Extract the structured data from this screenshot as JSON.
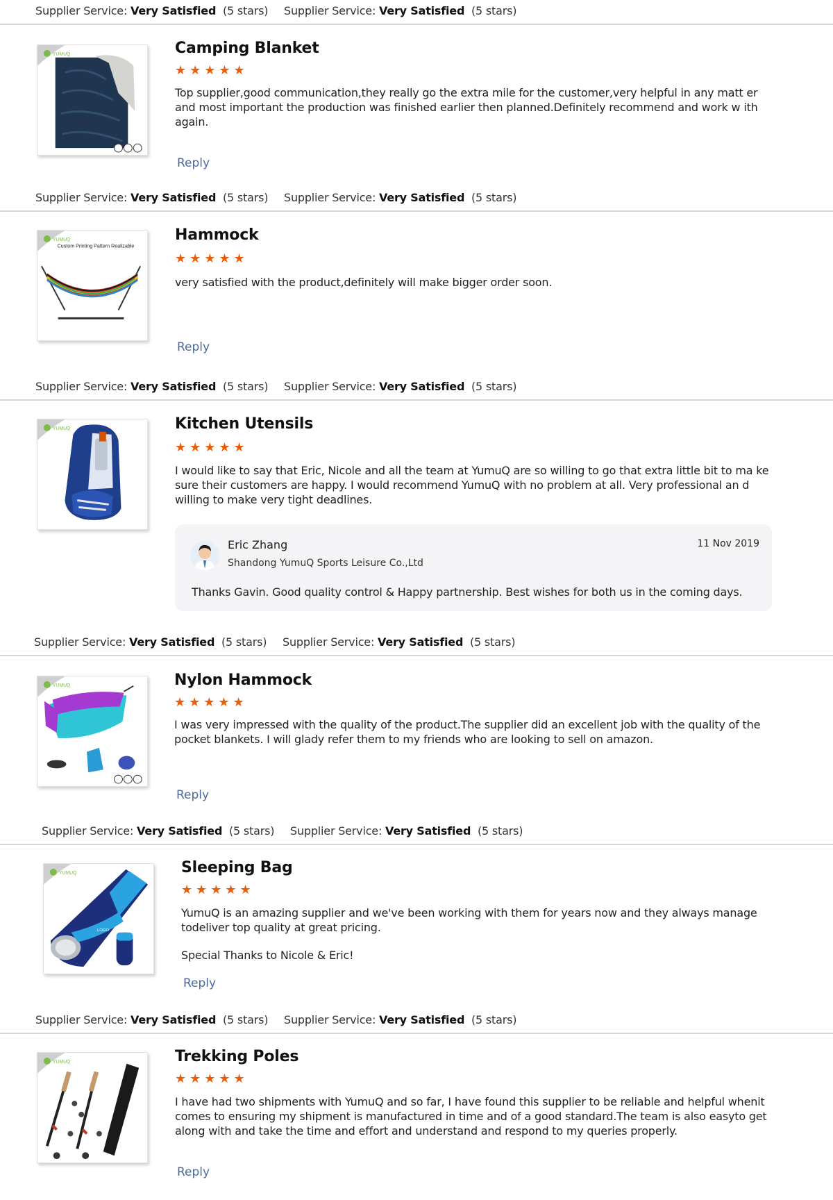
{
  "service_rows": [
    {
      "label": "Supplier Service:",
      "rating": "Very Satisfied",
      "stars": "(5 stars)"
    },
    {
      "label": "Supplier Service:",
      "rating": "Very Satisfied",
      "stars": "(5 stars)"
    }
  ],
  "reviews": [
    {
      "title": "Camping Blanket",
      "stars": "★★★★★",
      "rating": 5,
      "text": [
        "Top supplier,good communication,they really go the extra mile for the customer,very helpful in any matt er and most important the production was finished earlier then planned.Definitely recommend and work w ith again."
      ],
      "reply_label": "Reply",
      "image_icon": "camping-blanket-image"
    },
    {
      "title": "Hammock",
      "stars": "★★★★★",
      "rating": 5,
      "text": [
        "very satisfied with the product,definitely will make bigger order soon."
      ],
      "reply_label": "Reply",
      "image_icon": "hammock-image",
      "image_caption": "Custom Printing Pattern Realizable"
    },
    {
      "title": "Kitchen Utensils",
      "stars": "★★★★★",
      "rating": 5,
      "text": [
        "I would like to say that Eric, Nicole and all the team at YumuQ are so willing to go that extra little bit to ma ke sure their customers are happy. I would recommend YumuQ with no problem at all. Very professional an d willing to make very tight deadlines."
      ],
      "image_icon": "kitchen-utensils-image",
      "response": {
        "name": "Eric Zhang",
        "company": "Shandong YumuQ Sports Leisure Co.,Ltd",
        "date": "11 Nov 2019",
        "text": "Thanks Gavin. Good quality control & Happy partnership. Best wishes for both us in the coming days."
      }
    },
    {
      "title": "Nylon Hammock",
      "stars": "★★★★★",
      "rating": 5,
      "text": [
        "I was very impressed with the quality of the product.The supplier did an excellent job with the quality of the pocket blankets. I will glady refer them to my friends who are looking to sell on amazon."
      ],
      "reply_label": "Reply",
      "image_icon": "nylon-hammock-image"
    },
    {
      "title": "Sleeping Bag",
      "stars": "★★★★★",
      "rating": 5,
      "text": [
        "YumuQ is an amazing supplier and we've been working with them for years now and they always manage todeliver top quality at great pricing.",
        "Special Thanks to Nicole & Eric!"
      ],
      "reply_label": "Reply",
      "image_icon": "sleeping-bag-image",
      "image_label": "LOGO"
    },
    {
      "title": "Trekking Poles",
      "stars": "★★★★★",
      "rating": 5,
      "text": [
        "I have had two shipments with YumuQ and so far, I have found this supplier to be reliable and helpful whenit comes to ensuring my shipment is manufactured in time and of a good standard.The team is also easyto get along with and take the time and effort and understand and respond to my queries properly."
      ],
      "reply_label": "Reply",
      "image_icon": "trekking-poles-image"
    }
  ],
  "colors": {
    "star": "#ea5e0a",
    "reply_link": "#4b6a9b",
    "divider": "#d6d6d6",
    "response_bg": "#f4f4f6"
  }
}
